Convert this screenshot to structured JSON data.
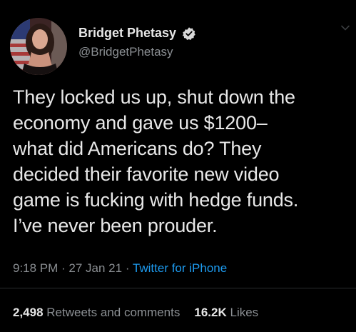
{
  "author": {
    "display_name": "Bridget Phetasy",
    "handle": "@BridgetPhetasy",
    "verified": true
  },
  "tweet": {
    "text": "They locked us up, shut down the\neconomy and gave us $1200–\nwhat did Americans do? They\ndecided their favorite new video\ngame is fucking with hedge funds.\nI’ve never been prouder."
  },
  "meta": {
    "time": "9:18 PM",
    "separator": " · ",
    "date": "27 Jan 21",
    "source": "Twitter for iPhone"
  },
  "stats": {
    "retweets_count": "2,498",
    "retweets_label": "Retweets and comments",
    "likes_count": "16.2K",
    "likes_label": "Likes"
  },
  "colors": {
    "background": "#000000",
    "text": "#e8e8e8",
    "muted": "#8b8f93",
    "link": "#1d9bf0",
    "verified": "#d9d9d9"
  },
  "icons": {
    "verified": "verified-badge-icon",
    "more": "chevron-down-icon"
  }
}
